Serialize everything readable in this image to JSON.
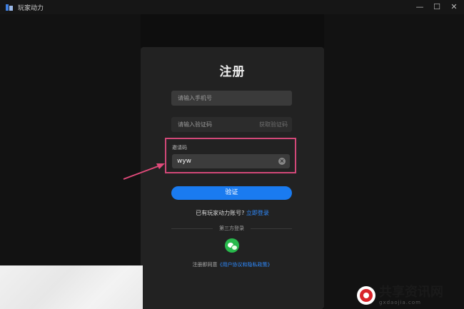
{
  "window": {
    "title": "玩家动力",
    "minimize": "—",
    "maximize": "☐",
    "close": "✕"
  },
  "register": {
    "title": "注册",
    "phone_placeholder": "请输入手机号",
    "code_placeholder": "请输入验证码",
    "get_code": "获取验证码",
    "invite_label": "邀请码",
    "invite_value": "wyw",
    "verify_button": "验证",
    "has_account": "已有玩家动力账号?",
    "login_link": "立即登录",
    "third_party": "第三方登录",
    "agreement_prefix": "注册即同意",
    "agreement_link": "《用户协议和隐私政策》"
  },
  "colors": {
    "accent": "#1a7bf0",
    "highlight_box": "#d24878",
    "wechat": "#28b94c"
  },
  "watermark": {
    "main": "共享资讯网",
    "sub": "gxdaojia.com"
  }
}
